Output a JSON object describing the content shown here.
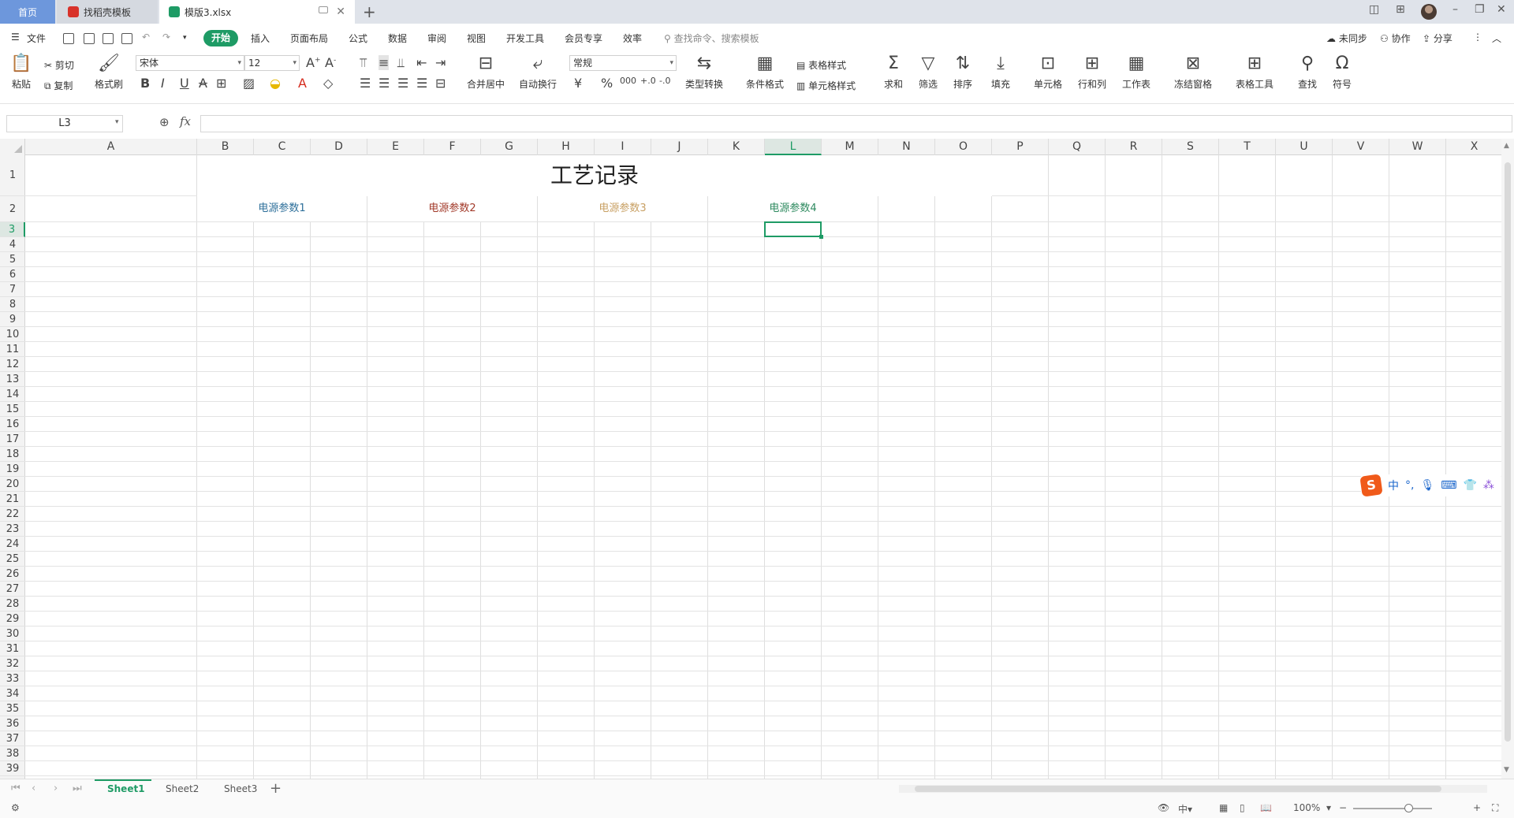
{
  "tabs": {
    "home": "首页",
    "daoke": "找稻壳模板",
    "file": "模版3.xlsx"
  },
  "menu": {
    "file": "文件",
    "items": [
      "开始",
      "插入",
      "页面布局",
      "公式",
      "数据",
      "审阅",
      "视图",
      "开发工具",
      "会员专享",
      "效率"
    ],
    "search_placeholder": "查找命令、搜索模板",
    "unsynced": "未同步",
    "collaborate": "协作",
    "share": "分享"
  },
  "ribbon": {
    "paste": "粘贴",
    "cut": "剪切",
    "copy": "复制",
    "format_painter": "格式刷",
    "font_name": "宋体",
    "font_size": "12",
    "merge_center": "合并居中",
    "wrap_text": "自动换行",
    "number_format": "常规",
    "type_convert": "类型转换",
    "cond_format": "条件格式",
    "table_style": "表格样式",
    "cell_style": "单元格样式",
    "sum": "求和",
    "filter": "筛选",
    "sort": "排序",
    "fill": "填充",
    "cell": "单元格",
    "row_col": "行和列",
    "worksheet": "工作表",
    "freeze": "冻结窗格",
    "table_tools": "表格工具",
    "find": "查找",
    "symbol": "符号"
  },
  "formula_bar": {
    "name_box": "L3",
    "fx": "fx",
    "formula": ""
  },
  "sheet": {
    "columns": [
      "A",
      "B",
      "C",
      "D",
      "E",
      "F",
      "G",
      "H",
      "I",
      "J",
      "K",
      "L",
      "M",
      "N",
      "O",
      "P",
      "Q",
      "R",
      "S",
      "T",
      "U",
      "V",
      "W",
      "X"
    ],
    "selected_column": "L",
    "selected_row": 3,
    "row_count": 40,
    "title": "工艺记录",
    "params": [
      {
        "label": "电源参数1",
        "color": "#2d6f9a"
      },
      {
        "label": "电源参数2",
        "color": "#a23a2a"
      },
      {
        "label": "电源参数3",
        "color": "#c8a064"
      },
      {
        "label": "电源参数4",
        "color": "#2e8a5f"
      }
    ]
  },
  "sheet_tabs": [
    "Sheet1",
    "Sheet2",
    "Sheet3"
  ],
  "status": {
    "zoom": "100%"
  },
  "ime": {
    "logo": "S",
    "mode": "中"
  }
}
